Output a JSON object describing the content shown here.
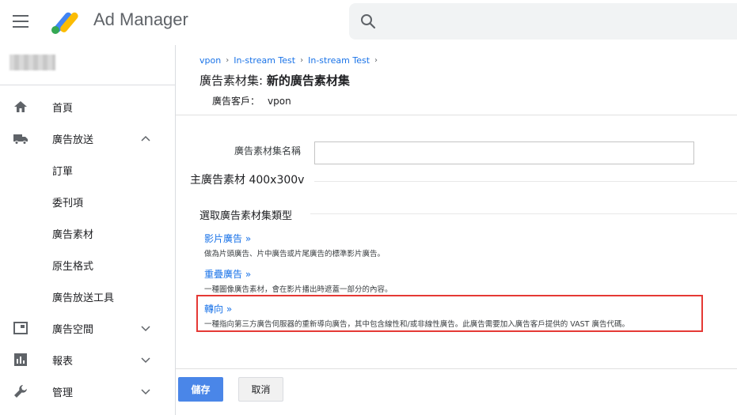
{
  "topbar": {
    "app_title": "Ad Manager",
    "search_placeholder": ""
  },
  "sidebar": {
    "items": [
      {
        "label": "首頁",
        "icon": "home-icon"
      },
      {
        "label": "廣告放送",
        "icon": "truck-icon",
        "expanded": true
      },
      {
        "label": "訂單"
      },
      {
        "label": "委刊項"
      },
      {
        "label": "廣告素材"
      },
      {
        "label": "原生格式"
      },
      {
        "label": "廣告放送工具"
      },
      {
        "label": "廣告空間",
        "icon": "inventory-icon"
      },
      {
        "label": "報表",
        "icon": "bar-chart-icon"
      },
      {
        "label": "管理",
        "icon": "wrench-icon"
      }
    ]
  },
  "breadcrumb": [
    "vpon",
    "In-stream Test",
    "In-stream Test"
  ],
  "page": {
    "title_prefix": "廣告素材集: ",
    "title_name": "新的廣告素材集",
    "advertiser_label": "廣告客戶：",
    "advertiser_value": "vpon"
  },
  "form": {
    "name_label": "廣告素材集名稱",
    "name_value": "",
    "master_section": "主廣告素材 400x300v",
    "type_section": "選取廣告素材集類型"
  },
  "options": [
    {
      "title": "影片廣告 »",
      "desc": "做為片頭廣告、片中廣告或片尾廣告的標準影片廣告。"
    },
    {
      "title": "重疊廣告 »",
      "desc": "一種圖像廣告素材，會在影片播出時遮蓋一部分的內容。"
    },
    {
      "title": "轉向 »",
      "desc": "一種指向第三方廣告伺服器的重新導向廣告，其中包含線性和/或非線性廣告。此廣告需要加入廣告客戶提供的 VAST 廣告代碼。"
    }
  ],
  "buttons": {
    "save": "儲存",
    "cancel": "取消"
  },
  "colors": {
    "accent": "#4a86e8",
    "link": "#1a73e8",
    "highlight": "#e53935"
  }
}
